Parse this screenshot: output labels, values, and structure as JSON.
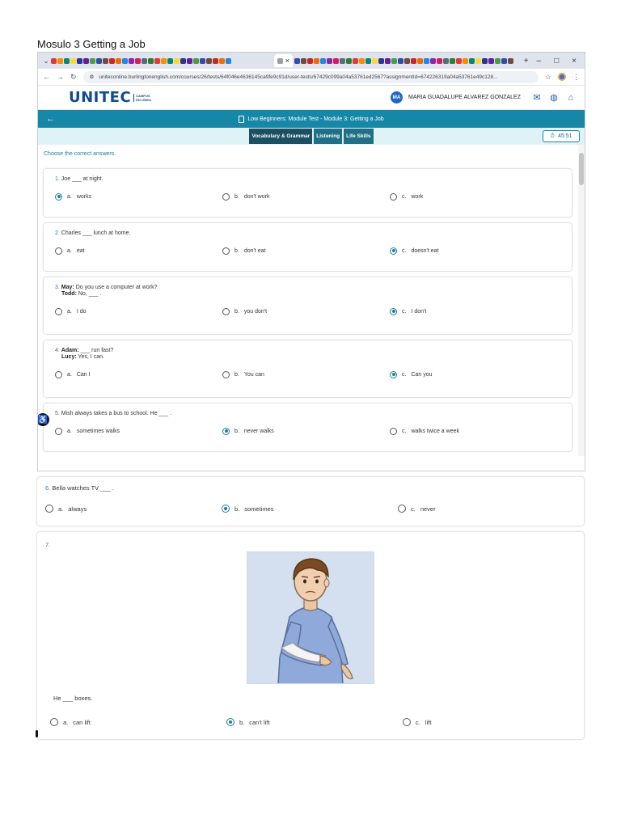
{
  "document": {
    "title": "Mosulo 3 Getting a Job"
  },
  "browser": {
    "tab_close": "×",
    "new_tab": "+",
    "window_controls": {
      "minimize": "–",
      "maximize": "□",
      "close": "×"
    },
    "url": "uniteconline.burlingtonenglish.com/courses/26/tests/64f046e4636145ca9fe9c91d/user-tests/67429c099a04a53761ed2567?assignmentId=674226319a04a53761e49c128...",
    "favicon_colors": [
      "#e53935",
      "#1e88e5",
      "#43a047",
      "#fb8c00",
      "#8e24aa",
      "#3949ab",
      "#00897b",
      "#d81b60",
      "#6d4c41",
      "#fdd835",
      "#546e7a",
      "#c62828",
      "#283593",
      "#2e7d32",
      "#ef6c00",
      "#6a1b9a"
    ]
  },
  "header": {
    "logo": "UNITEC",
    "logo_sub_1": "CAMPUS",
    "logo_sub_2": "EN LÍNEA",
    "avatar_initials": "MA",
    "user_name": "MARIA GUADALUPE ALVAREZ GONZALEZ"
  },
  "module": {
    "title": "Low Beginners: Module Test - Module 3: Getting a Job"
  },
  "tabs": [
    "Vocabulary & Grammar",
    "Listening",
    "Life Skills"
  ],
  "timer": "45:51",
  "instructions": "Choose the correct answers.",
  "questions": [
    {
      "num": "1.",
      "text": "Joe ___ at night.",
      "options": [
        {
          "letter": "a.",
          "text": "works",
          "selected": true
        },
        {
          "letter": "b.",
          "text": "don't work",
          "selected": false
        },
        {
          "letter": "c.",
          "text": "work",
          "selected": false
        }
      ]
    },
    {
      "num": "2.",
      "text": "Charles ___ lunch at home.",
      "options": [
        {
          "letter": "a.",
          "text": "eat",
          "selected": false
        },
        {
          "letter": "b.",
          "text": "don't eat",
          "selected": false
        },
        {
          "letter": "c.",
          "text": "doesn't eat",
          "selected": true
        }
      ]
    },
    {
      "num": "3.",
      "speaker1": "May:",
      "line1": "Do you use a computer at work?",
      "speaker2": "Todd:",
      "line2": "No, ___ .",
      "options": [
        {
          "letter": "a.",
          "text": "I do",
          "selected": false
        },
        {
          "letter": "b.",
          "text": "you don't",
          "selected": false
        },
        {
          "letter": "c.",
          "text": "I don't",
          "selected": true
        }
      ]
    },
    {
      "num": "4.",
      "speaker1": "Adam:",
      "line1": "___ run fast?",
      "speaker2": "Lucy:",
      "line2": "Yes, I can.",
      "options": [
        {
          "letter": "a.",
          "text": "Can I",
          "selected": false
        },
        {
          "letter": "b.",
          "text": "You can",
          "selected": false
        },
        {
          "letter": "c.",
          "text": "Can you",
          "selected": true
        }
      ]
    },
    {
      "num": "5.",
      "text": "Mish always takes a bus to school. He ___ .",
      "options": [
        {
          "letter": "a.",
          "text": "sometimes walks",
          "selected": false
        },
        {
          "letter": "b.",
          "text": "never walks",
          "selected": true
        },
        {
          "letter": "c.",
          "text": "walks twice a week",
          "selected": false
        }
      ]
    },
    {
      "num": "6.",
      "text": "Bella watches TV ___ .",
      "options": [
        {
          "letter": "a.",
          "text": "always",
          "selected": false
        },
        {
          "letter": "b.",
          "text": "sometimes",
          "selected": true
        },
        {
          "letter": "c.",
          "text": "never",
          "selected": false
        }
      ]
    },
    {
      "num": "7.",
      "text": "He ___ boxes.",
      "options": [
        {
          "letter": "a.",
          "text": "can lift",
          "selected": false
        },
        {
          "letter": "b.",
          "text": "can't lift",
          "selected": true
        },
        {
          "letter": "c.",
          "text": "lift",
          "selected": false
        }
      ]
    }
  ],
  "colors": {
    "accent": "#1787a8",
    "logo": "#0f4c8f",
    "radio_selected": "#1d7ea1"
  }
}
